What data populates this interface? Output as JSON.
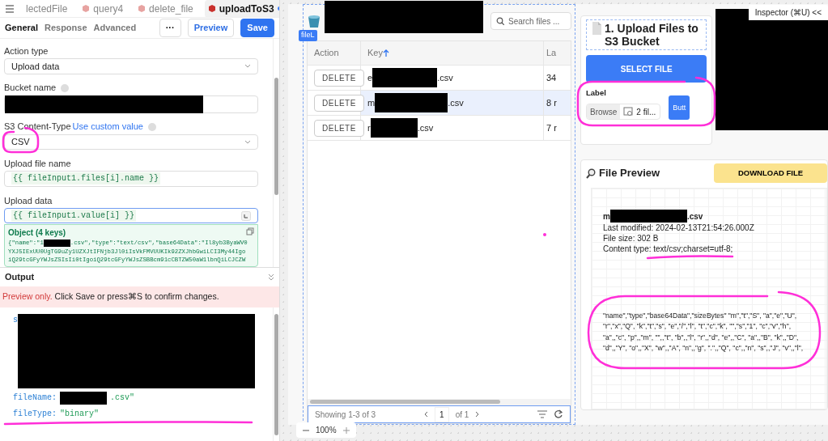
{
  "query_tabs": [
    {
      "label": "lectedFile",
      "icon": false,
      "selected": false,
      "unsaved": false
    },
    {
      "label": "query4",
      "icon": true,
      "selected": false,
      "unsaved": false
    },
    {
      "label": "delete_file",
      "icon": true,
      "selected": false,
      "unsaved": false
    },
    {
      "label": "uploadToS3",
      "icon": true,
      "selected": true,
      "unsaved": true
    }
  ],
  "editor_tabs": [
    {
      "label": "General",
      "selected": true
    },
    {
      "label": "Response",
      "selected": false
    },
    {
      "label": "Advanced",
      "selected": false
    }
  ],
  "editor_buttons": {
    "more": "···",
    "preview": "Preview",
    "save": "Save"
  },
  "fields": [
    {
      "kind": "select",
      "label": "Action type",
      "value": "Upload data"
    },
    {
      "kind": "redacted",
      "label": "Bucket name",
      "help": true
    },
    {
      "kind": "select",
      "label": "S3 Content-Type",
      "link": "Use custom value",
      "help": true,
      "value": "CSV"
    },
    {
      "kind": "code",
      "label": "Upload file name",
      "value": "{{ fileInput1.files[i].name }}",
      "focused": false
    },
    {
      "kind": "code",
      "label": "Upload data",
      "value": "{{ fileInput1.value[i] }}",
      "focused": true
    }
  ],
  "object_preview": {
    "title": "Object (4 keys)",
    "lines": [
      [
        "{\"name\":\"1",
        ".csv\",\"type\":\"text/csv\",\"base64Data\":\"Il8yb3ByaWV0"
      ],
      [
        "YXJ5IExUU0UgTG9uZy1UZXJtIFNjb3Jl0iIsVkFMVUUKIk92ZXJhbGwiLCI3My44Igo"
      ],
      [
        "iQ29tcGFyYWJsZSIsIi0tIgoiQ29tcGFyYWJsZSBBcm91cCBTZW50aW1lbnQiLCJCZW"
      ]
    ]
  },
  "output": {
    "title": "Output",
    "notice_strong": "Preview only.",
    "notice": "Click Save or press⌘S to confirm changes.",
    "lines": [
      {
        "key": "s",
        "block": true
      },
      {
        "key": "fileName:",
        "value": ".csv\"",
        "redacted_before": true
      },
      {
        "key": "fileType:",
        "value": "\"binary\"",
        "redacted_before": false
      }
    ]
  },
  "table": {
    "tag": "fileL",
    "search_placeholder": "Search files ...",
    "columns": [
      {
        "label": "Action",
        "sorted": false
      },
      {
        "label": "Key",
        "sorted": true
      },
      {
        "label": "La",
        "sorted": false
      }
    ],
    "rows": [
      {
        "action": "DELETE",
        "key": [
          "e",
          ".csv"
        ],
        "column_3": "34",
        "selected": false
      },
      {
        "action": "DELETE",
        "key": [
          "m",
          ".csv"
        ],
        "column_3": "8 r",
        "selected": true
      },
      {
        "action": "DELETE",
        "key": [
          "r",
          ".csv"
        ],
        "column_3": "7 r",
        "selected": false
      }
    ],
    "footer": "Showing 1-3 of 3",
    "page": "1",
    "page_of": "of 1"
  },
  "zoom": "100%",
  "inspector": {
    "label": "Inspector (⌘U)",
    "collapse": "<<"
  },
  "upload_card": {
    "title": "1. Upload Files to S3 Bucket",
    "select_button": "SELECT FILE",
    "file_label": "Label",
    "browse": "Browse",
    "file_value": "2 fil...",
    "small_button": "Butt"
  },
  "preview_card": {
    "title": "File Preview",
    "download_button": "DOWNLOAD FILE",
    "file_name": [
      "m",
      ".csv"
    ],
    "details": [
      "Last modified: 2024-02-13T21:54:26.000Z",
      "File size: 302 B",
      "Content type: text/csv;charset=utf-8;"
    ],
    "data_text": "\"name\",\"type\",\"base64Data\",\"sizeBytes\" \"m\",\"t\",\"S\", \"a\",\"e\",\"U\", \"r\",\"x\",\"Q\", \"k\",\"t\",\"s\", \"e\",\"/\",\"l\", \"t\",\"c\",\"k\", \"\",\"s\",\"1\", \"c\",\"v\",\"h\", \"a\",,\"c\", \"p\",,\"m\", \"\",,\"t\", \"b\",,\"l\", \"r\",,\"d\", \"e\",,\"C\", \"a\",,\"B\", \"k\",,\"D\", \"d\",,\"Y\", \"o\",,\"X\", \"w\",,\"A\", \"n\",,\"g\", \".\",,\"Q\", \"c\",,\"n\", \"s\",,\"J\", \"v\",,\"l\","
  }
}
